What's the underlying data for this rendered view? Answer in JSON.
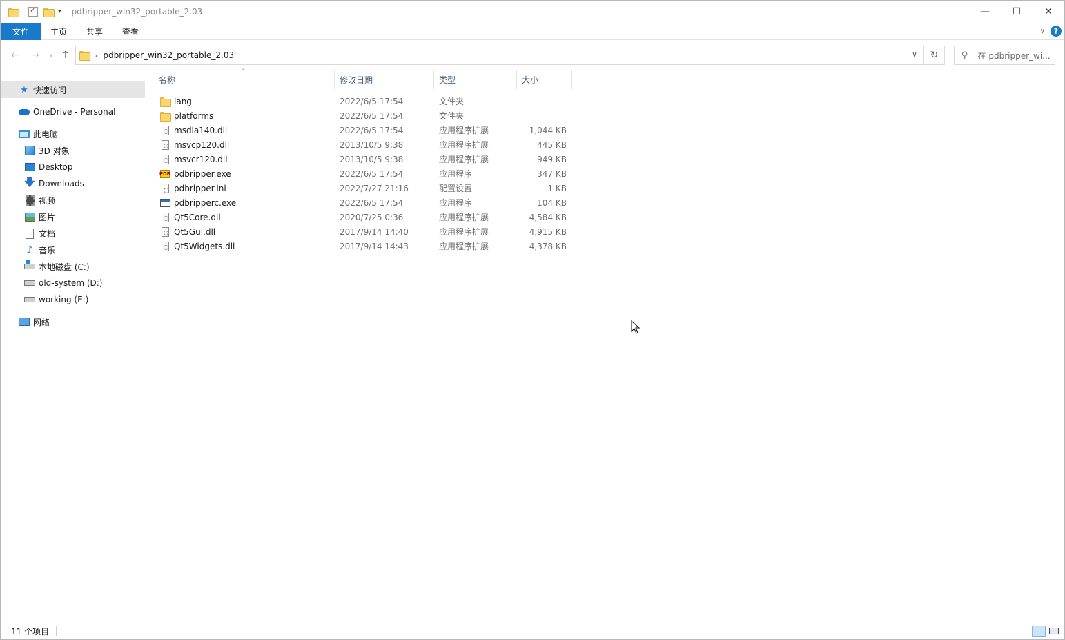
{
  "window": {
    "title": "pdbripper_win32_portable_2.03",
    "controls": {
      "minimize": "—",
      "maximize": "☐",
      "close": "✕"
    }
  },
  "ribbon": {
    "tabs": [
      "文件",
      "主页",
      "共享",
      "查看"
    ],
    "help": "?"
  },
  "address": {
    "breadcrumb": "pdbripper_win32_portable_2.03",
    "search_placeholder": "在 pdbripper_wi..."
  },
  "sidebar": {
    "items": [
      {
        "label": "快速访问",
        "icon": "star-icon"
      },
      {
        "label": "OneDrive - Personal",
        "icon": "onedrive-cloud-icon"
      },
      {
        "label": "此电脑",
        "icon": "computer-icon"
      },
      {
        "label": "3D 对象",
        "icon": "3d-objects-icon"
      },
      {
        "label": "Desktop",
        "icon": "desktop-icon"
      },
      {
        "label": "Downloads",
        "icon": "download-icon"
      },
      {
        "label": "视频",
        "icon": "video-icon"
      },
      {
        "label": "图片",
        "icon": "pictures-icon"
      },
      {
        "label": "文档",
        "icon": "documents-icon"
      },
      {
        "label": "音乐",
        "icon": "music-icon"
      },
      {
        "label": "本地磁盘 (C:)",
        "icon": "system-drive-icon"
      },
      {
        "label": "old-system (D:)",
        "icon": "drive-icon"
      },
      {
        "label": "working (E:)",
        "icon": "drive-icon"
      },
      {
        "label": "网络",
        "icon": "network-icon"
      }
    ]
  },
  "columns": {
    "name": "名称",
    "date": "修改日期",
    "type": "类型",
    "size": "大小"
  },
  "files": [
    {
      "name": "lang",
      "date": "2022/6/5 17:54",
      "type": "文件夹",
      "size": "",
      "icon": "folder-icon"
    },
    {
      "name": "platforms",
      "date": "2022/6/5 17:54",
      "type": "文件夹",
      "size": "",
      "icon": "folder-icon"
    },
    {
      "name": "msdia140.dll",
      "date": "2022/6/5 17:54",
      "type": "应用程序扩展",
      "size": "1,044 KB",
      "icon": "dll-file-icon"
    },
    {
      "name": "msvcp120.dll",
      "date": "2013/10/5 9:38",
      "type": "应用程序扩展",
      "size": "445 KB",
      "icon": "dll-file-icon"
    },
    {
      "name": "msvcr120.dll",
      "date": "2013/10/5 9:38",
      "type": "应用程序扩展",
      "size": "949 KB",
      "icon": "dll-file-icon"
    },
    {
      "name": "pdbripper.exe",
      "date": "2022/6/5 17:54",
      "type": "应用程序",
      "size": "347 KB",
      "icon": "pdbripper-app-icon"
    },
    {
      "name": "pdbripper.ini",
      "date": "2022/7/27 21:16",
      "type": "配置设置",
      "size": "1 KB",
      "icon": "ini-settings-icon"
    },
    {
      "name": "pdbripperc.exe",
      "date": "2022/6/5 17:54",
      "type": "应用程序",
      "size": "104 KB",
      "icon": "console-app-icon"
    },
    {
      "name": "Qt5Core.dll",
      "date": "2020/7/25 0:36",
      "type": "应用程序扩展",
      "size": "4,584 KB",
      "icon": "dll-file-icon"
    },
    {
      "name": "Qt5Gui.dll",
      "date": "2017/9/14 14:40",
      "type": "应用程序扩展",
      "size": "4,915 KB",
      "icon": "dll-file-icon"
    },
    {
      "name": "Qt5Widgets.dll",
      "date": "2017/9/14 14:43",
      "type": "应用程序扩展",
      "size": "4,378 KB",
      "icon": "dll-file-icon"
    }
  ],
  "status": {
    "item_count": "11 个项目"
  },
  "colors": {
    "file_tab": "#1979ca",
    "selected_nav": "#e5e5e5",
    "header_text": "#4c607a",
    "folder": "#fcd66b"
  }
}
